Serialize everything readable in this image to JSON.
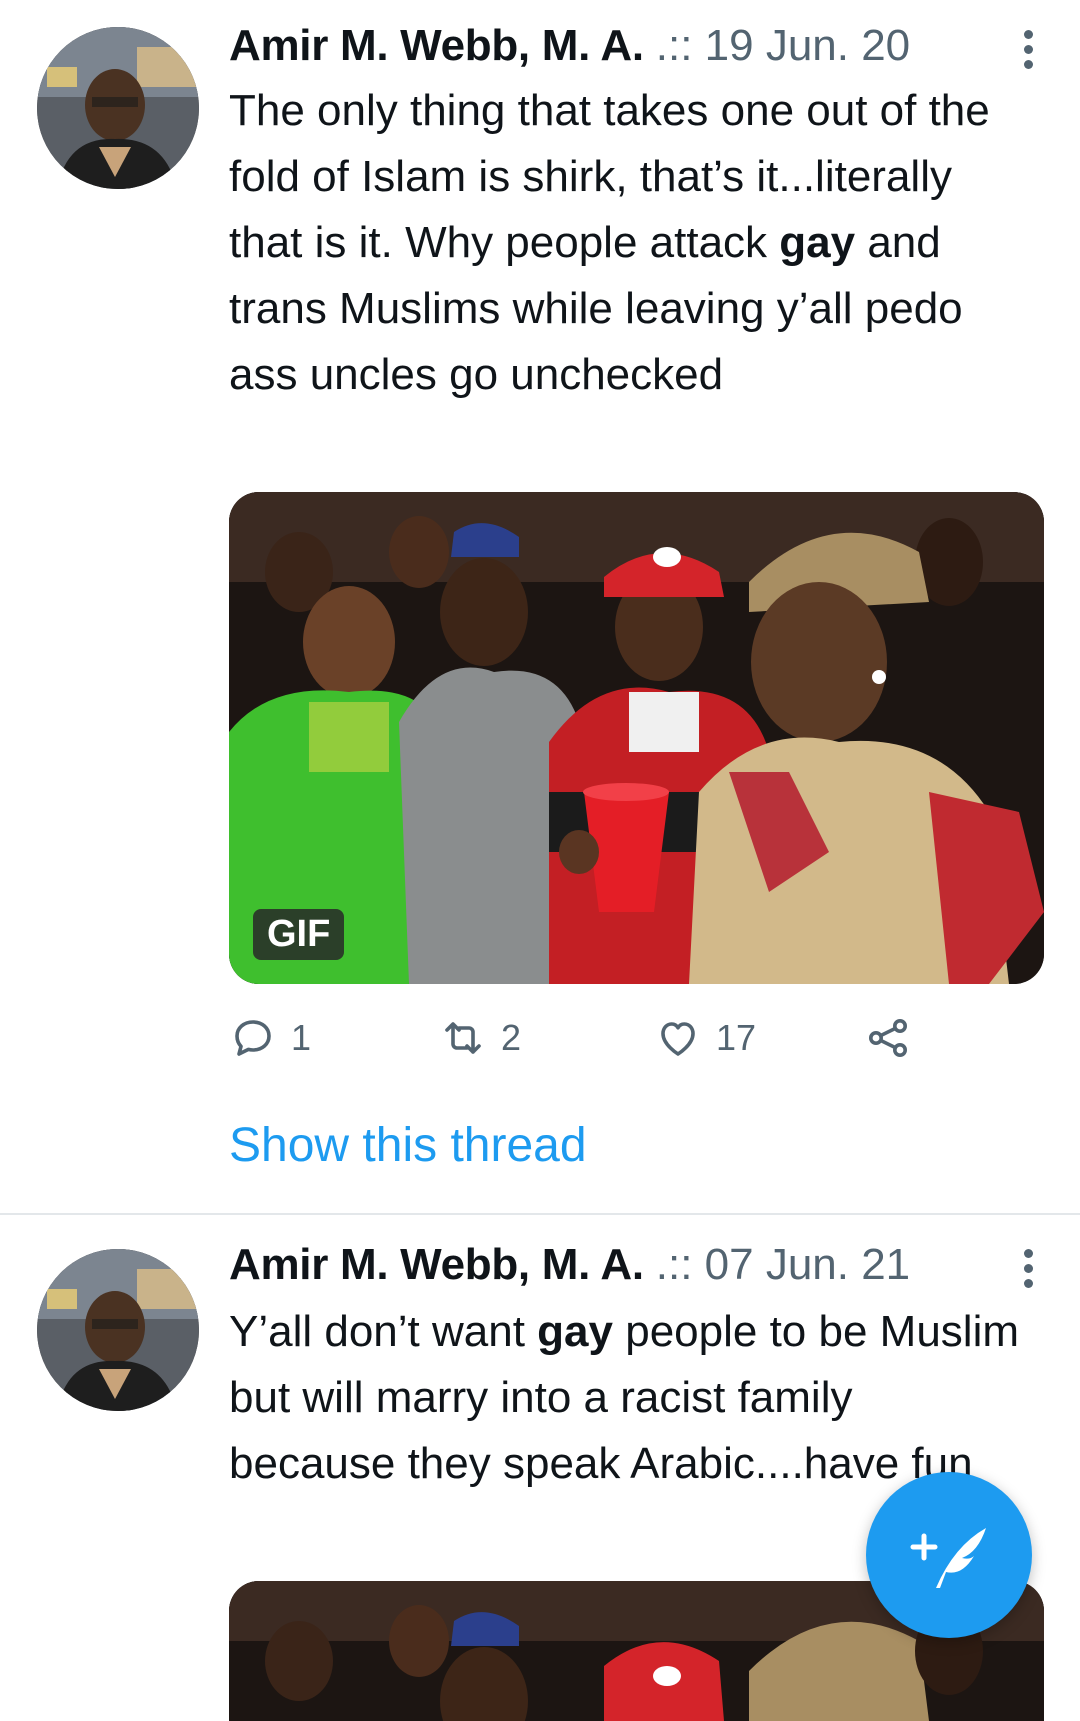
{
  "tweets": [
    {
      "author": "Amir M. Webb, M. A.",
      "meta": ".:: 19 Jun. 20",
      "text_parts": [
        "The only thing that takes one out of the fold of Islam is shirk, that’s it...literally that is it. Why people attack ",
        "gay",
        " and trans Muslims while leaving y’all pedo ass uncles go unchecked"
      ],
      "media_badge": "GIF",
      "replies": "1",
      "retweets": "2",
      "likes": "17",
      "show_thread": "Show this thread"
    },
    {
      "author": "Amir M. Webb, M. A.",
      "meta": ".:: 07 Jun. 21",
      "text_parts": [
        "Y’all don’t want ",
        "gay",
        " people to be Muslim but will marry into a racist family because they speak Arabic....have fun"
      ]
    }
  ],
  "icons": {
    "reply": "reply-icon",
    "retweet": "retweet-icon",
    "like": "heart-icon",
    "share": "share-icon",
    "compose": "compose-tweet-icon",
    "more": "more-vertical-icon"
  },
  "colors": {
    "accent": "#1d9bf0",
    "secondary_text": "#536471",
    "primary_text": "#0f1419"
  }
}
